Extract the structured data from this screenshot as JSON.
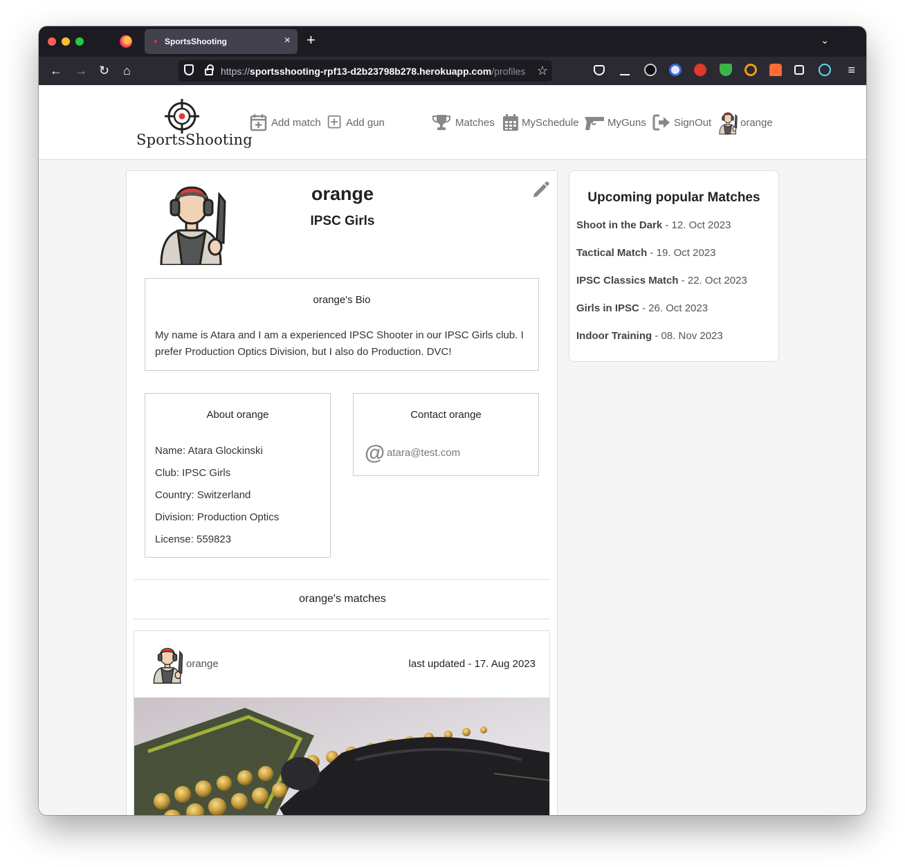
{
  "browser": {
    "tab_title": "SportsShooting",
    "tab_close": "×",
    "new_tab": "+",
    "tab_list": "⌄",
    "url_proto": "https://",
    "url_host": "sportsshooting-rpf13-d2b23798b278.herokuapp.com",
    "url_path": "/profiles",
    "back": "←",
    "forward": "→",
    "reload": "↻",
    "home": "⌂",
    "bookmark": "☆",
    "menu": "≡"
  },
  "header": {
    "logo_text": "SportsShooting",
    "nav": {
      "add_match": "Add match",
      "add_gun": "Add gun",
      "matches": "Matches",
      "myschedule": "MySchedule",
      "myguns": "MyGuns",
      "signout": "SignOut",
      "user": "orange"
    }
  },
  "profile": {
    "name": "orange",
    "club": "IPSC Girls",
    "bio_title": "orange's Bio",
    "bio_text": "My name is Atara and I am a experienced IPSC Shooter in our IPSC Girls club. I prefer Production Optics Division, but I also do Production. DVC!",
    "about_title": "About orange",
    "about": {
      "name": "Name: Atara Glockinski",
      "club": "Club: IPSC Girls",
      "country": "Country: Switzerland",
      "division": "Division: Production Optics",
      "license": "License: 559823"
    },
    "contact_title": "Contact orange",
    "email": "atara@test.com",
    "matches_title": "orange's matches",
    "match_card": {
      "user": "orange",
      "updated": "last updated - 17. Aug 2023"
    }
  },
  "upcoming": {
    "title": "Upcoming popular Matches",
    "items": [
      {
        "name": "Shoot in the Dark",
        "date": " - 12. Oct 2023"
      },
      {
        "name": "Tactical Match",
        "date": " - 19. Oct 2023"
      },
      {
        "name": "IPSC Classics Match",
        "date": " - 22. Oct 2023"
      },
      {
        "name": "Girls in IPSC",
        "date": " - 26. Oct 2023"
      },
      {
        "name": "Indoor Training",
        "date": " - 08. Nov 2023"
      }
    ]
  },
  "colors": {
    "accent": "#e53935",
    "icon_gray": "#888888",
    "browser_dark": "#1c1b22"
  }
}
